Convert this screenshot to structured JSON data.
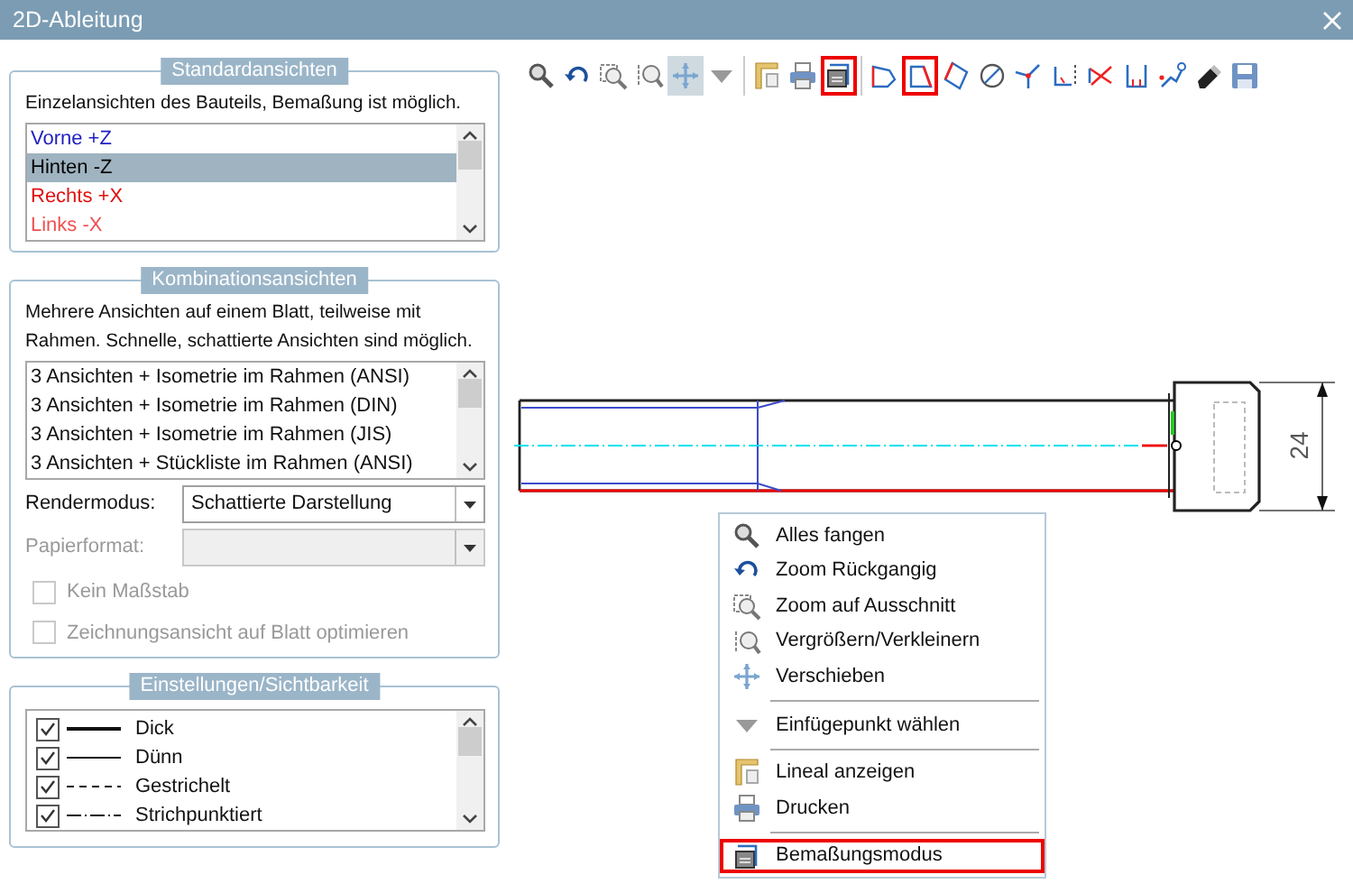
{
  "window": {
    "title": "2D-Ableitung"
  },
  "standard_views": {
    "title": "Standardansichten",
    "description": "Einzelansichten des Bauteils, Bemaßung ist möglich.",
    "items": [
      {
        "label": "Vorne +Z",
        "color": "#2020c0",
        "selected": false
      },
      {
        "label": "Hinten -Z",
        "color": "#000000",
        "selected": true
      },
      {
        "label": "Rechts +X",
        "color": "#e01010",
        "selected": false
      },
      {
        "label": "Links -X",
        "color": "#f05050",
        "selected": false
      }
    ]
  },
  "combination_views": {
    "title": "Kombinationsansichten",
    "description": "Mehrere Ansichten auf einem Blatt, teilweise mit Rahmen. Schnelle, schattierte Ansichten sind möglich.",
    "items": [
      {
        "label": "3 Ansichten + Isometrie im Rahmen (ANSI)",
        "selected": false
      },
      {
        "label": "3 Ansichten + Isometrie im Rahmen (DIN)",
        "selected": false
      },
      {
        "label": "3 Ansichten + Isometrie im Rahmen (JIS)",
        "selected": false
      },
      {
        "label": "3 Ansichten + Stückliste im Rahmen (ANSI)",
        "selected": false
      }
    ],
    "fields": [
      {
        "label": "Rendermodus:",
        "value": "Schattierte Darstellung",
        "disabled": false
      },
      {
        "label": "Papierformat:",
        "disabled": true
      }
    ],
    "checkboxes": [
      {
        "label": "Kein Maßstab",
        "checked": false,
        "disabled": true
      },
      {
        "label": "Zeichnungsansicht auf Blatt optimieren",
        "checked": false,
        "disabled": true
      }
    ]
  },
  "settings": {
    "title": "Einstellungen/Sichtbarkeit",
    "items": [
      {
        "label": "Dick",
        "checked": true,
        "kind": "thick"
      },
      {
        "label": "Dünn",
        "checked": true,
        "kind": "thin"
      },
      {
        "label": "Gestrichelt",
        "checked": true,
        "kind": "dashed"
      },
      {
        "label": "Strichpunktiert",
        "checked": true,
        "kind": "dashdot"
      }
    ]
  },
  "toolbar": [
    {
      "kind": "magnifier",
      "highlighted": false,
      "pressed": false
    },
    {
      "kind": "undo",
      "highlighted": false,
      "pressed": false
    },
    {
      "kind": "zoomwin",
      "highlighted": false,
      "pressed": false
    },
    {
      "kind": "zoomscale",
      "highlighted": false,
      "pressed": false
    },
    {
      "kind": "pan",
      "highlighted": false,
      "pressed": true
    },
    {
      "kind": "triangle",
      "highlighted": false,
      "pressed": false
    },
    {
      "kind": "separator"
    },
    {
      "kind": "ruler",
      "highlighted": false,
      "pressed": false
    },
    {
      "kind": "printer",
      "highlighted": false,
      "pressed": false
    },
    {
      "kind": "dimension",
      "highlighted": true,
      "pressed": false
    },
    {
      "kind": "separator"
    },
    {
      "kind": "polyline",
      "highlighted": false,
      "pressed": false
    },
    {
      "kind": "quad",
      "highlighted": true,
      "pressed": false
    },
    {
      "kind": "slant",
      "highlighted": false,
      "pressed": false
    },
    {
      "kind": "circle",
      "highlighted": false,
      "pressed": false
    },
    {
      "kind": "fork",
      "highlighted": false,
      "pressed": false
    },
    {
      "kind": "corner",
      "highlighted": false,
      "pressed": false
    },
    {
      "kind": "cross",
      "highlighted": false,
      "pressed": false
    },
    {
      "kind": "bracket",
      "highlighted": false,
      "pressed": false
    },
    {
      "kind": "chain",
      "highlighted": false,
      "pressed": false
    },
    {
      "kind": "eraser",
      "highlighted": false,
      "pressed": false
    },
    {
      "kind": "save",
      "highlighted": false,
      "pressed": false
    }
  ],
  "drawing": {
    "dimension": "24"
  },
  "context_menu": [
    {
      "kind": "magnifier",
      "label": "Alles fangen",
      "highlighted": false
    },
    {
      "kind": "undo",
      "label": "Zoom Rückgangig",
      "highlighted": false
    },
    {
      "kind": "zoomwin",
      "label": "Zoom auf Ausschnitt",
      "highlighted": false
    },
    {
      "kind": "zoomscale",
      "label": "Vergrößern/Verkleinern",
      "highlighted": false
    },
    {
      "kind": "pan",
      "label": "Verschieben",
      "highlighted": false
    },
    {
      "kind": "separator"
    },
    {
      "kind": "triangle",
      "label": "Einfügepunkt wählen",
      "highlighted": false
    },
    {
      "kind": "separator"
    },
    {
      "kind": "ruler",
      "label": "Lineal anzeigen",
      "highlighted": false
    },
    {
      "kind": "printer",
      "label": "Drucken",
      "highlighted": false
    },
    {
      "kind": "separator"
    },
    {
      "kind": "dimension",
      "label": "Bemaßungsmodus",
      "highlighted": true
    }
  ]
}
